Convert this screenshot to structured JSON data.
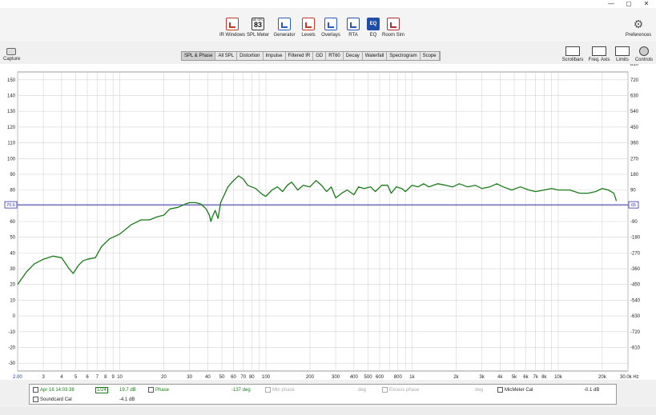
{
  "window": {
    "minimize": "—",
    "restore": "▢",
    "close": "✕"
  },
  "toolbar": {
    "items": [
      {
        "label": "IR Windows",
        "icon": "ir-windows-icon",
        "color": "#c03a2b"
      },
      {
        "label": "SPL Meter",
        "icon": "spl-meter-icon",
        "color": "#333333",
        "badge_top": "dB SPL",
        "badge_value": "83"
      },
      {
        "label": "Generator",
        "icon": "generator-icon",
        "color": "#2b5cb8"
      },
      {
        "label": "Levels",
        "icon": "levels-icon",
        "color": "#c0392b"
      },
      {
        "label": "Overlays",
        "icon": "overlays-icon",
        "color": "#2b5cb8"
      },
      {
        "label": "RTA",
        "icon": "rta-icon",
        "color": "#2b4fb8"
      },
      {
        "label": "EQ",
        "icon": "eq-icon",
        "color": "#1f4ea8",
        "badge_value": "EQ"
      },
      {
        "label": "Room Sim",
        "icon": "room-sim-icon",
        "color": "#b03030"
      }
    ],
    "preferences": "Preferences"
  },
  "capture": "Capture",
  "tabs": [
    {
      "label": "SPL & Phase",
      "active": true
    },
    {
      "label": "All SPL"
    },
    {
      "label": "Distortion"
    },
    {
      "label": "Impulse"
    },
    {
      "label": "Filtered IR"
    },
    {
      "label": "GD"
    },
    {
      "label": "RT60"
    },
    {
      "label": "Decay"
    },
    {
      "label": "Waterfall"
    },
    {
      "label": "Spectrogram"
    },
    {
      "label": "Scope"
    }
  ],
  "right_tools": [
    {
      "label": "Scrollbars",
      "icon": "scrollbars-icon"
    },
    {
      "label": "Freq. Axis",
      "icon": "freq-axis-icon"
    },
    {
      "label": "Limits",
      "icon": "limits-icon"
    },
    {
      "label": "Controls",
      "icon": "controls-icon"
    }
  ],
  "left_unit": "dB",
  "right_unit": "deg",
  "chart_data": {
    "type": "line",
    "x_scale": "log",
    "xlim": [
      2,
      30000
    ],
    "ylim": [
      -35,
      155
    ],
    "y2lim": [
      -945,
      765
    ],
    "x_ticks": [
      "2.00",
      "3",
      "4",
      "5",
      "6",
      "7",
      "8",
      "9",
      "10",
      "20",
      "30",
      "40",
      "50",
      "60",
      "70",
      "80",
      "100",
      "200",
      "300",
      "400",
      "500",
      "600",
      "800",
      "1k",
      "2k",
      "3k",
      "4k",
      "5k",
      "6k",
      "7k",
      "8k",
      "10k",
      "20k",
      "30.0k Hz"
    ],
    "y_ticks": [
      "150",
      "140",
      "130",
      "120",
      "110",
      "100",
      "90",
      "80",
      "70",
      "60",
      "50",
      "40",
      "30",
      "20",
      "10",
      "0",
      "-10",
      "-20",
      "-30"
    ],
    "y2_ticks": [
      "810",
      "720",
      "630",
      "540",
      "450",
      "360",
      "270",
      "180",
      "90",
      "-90",
      "-180",
      "-270",
      "-360",
      "-450",
      "-540",
      "-630",
      "-720",
      "-810"
    ],
    "grid": true,
    "marker_left": "70.6",
    "marker_right": "65",
    "marker_value": 70.6,
    "marker_color": "#3333aa",
    "series": [
      {
        "color": "#1a7a1a",
        "points": [
          [
            2,
            20
          ],
          [
            2.3,
            28
          ],
          [
            2.6,
            33
          ],
          [
            3,
            36
          ],
          [
            3.5,
            38
          ],
          [
            4,
            37
          ],
          [
            4.5,
            30
          ],
          [
            4.8,
            27
          ],
          [
            5.2,
            32
          ],
          [
            5.6,
            35
          ],
          [
            6,
            36
          ],
          [
            6.8,
            37
          ],
          [
            7.5,
            44
          ],
          [
            8.5,
            49
          ],
          [
            10,
            52
          ],
          [
            12,
            58
          ],
          [
            14,
            61
          ],
          [
            16,
            61
          ],
          [
            18,
            63
          ],
          [
            20,
            64
          ],
          [
            22,
            68
          ],
          [
            25,
            69
          ],
          [
            28,
            71
          ],
          [
            30,
            72
          ],
          [
            33,
            72
          ],
          [
            36,
            71
          ],
          [
            39,
            68
          ],
          [
            41,
            64
          ],
          [
            42,
            60
          ],
          [
            43,
            63
          ],
          [
            45,
            67
          ],
          [
            47,
            62
          ],
          [
            49,
            72
          ],
          [
            55,
            82
          ],
          [
            60,
            86
          ],
          [
            65,
            89
          ],
          [
            70,
            87
          ],
          [
            75,
            83
          ],
          [
            85,
            81
          ],
          [
            95,
            77
          ],
          [
            100,
            76
          ],
          [
            110,
            80
          ],
          [
            120,
            82
          ],
          [
            130,
            79
          ],
          [
            140,
            83
          ],
          [
            150,
            85
          ],
          [
            165,
            80
          ],
          [
            180,
            83
          ],
          [
            200,
            82
          ],
          [
            220,
            86
          ],
          [
            240,
            83
          ],
          [
            260,
            79
          ],
          [
            280,
            82
          ],
          [
            300,
            75
          ],
          [
            330,
            78
          ],
          [
            360,
            80
          ],
          [
            400,
            77
          ],
          [
            430,
            82
          ],
          [
            470,
            81
          ],
          [
            520,
            82
          ],
          [
            560,
            79
          ],
          [
            620,
            83
          ],
          [
            680,
            83
          ],
          [
            720,
            78
          ],
          [
            780,
            82
          ],
          [
            850,
            81
          ],
          [
            900,
            79
          ],
          [
            1000,
            83
          ],
          [
            1100,
            82
          ],
          [
            1200,
            84
          ],
          [
            1300,
            82
          ],
          [
            1500,
            84
          ],
          [
            1700,
            83
          ],
          [
            1900,
            82
          ],
          [
            2100,
            84
          ],
          [
            2400,
            82
          ],
          [
            2700,
            83
          ],
          [
            3000,
            81
          ],
          [
            3400,
            82
          ],
          [
            3800,
            84
          ],
          [
            4200,
            82
          ],
          [
            4800,
            80
          ],
          [
            5500,
            82
          ],
          [
            6300,
            80
          ],
          [
            7000,
            79
          ],
          [
            8000,
            80
          ],
          [
            9000,
            81
          ],
          [
            10000,
            80
          ],
          [
            12000,
            80
          ],
          [
            14000,
            78
          ],
          [
            16000,
            78
          ],
          [
            18000,
            79
          ],
          [
            20000,
            81
          ],
          [
            22000,
            80
          ],
          [
            24000,
            78
          ],
          [
            25000,
            73
          ]
        ]
      }
    ]
  },
  "legend": {
    "row1": {
      "date": "Apr 16 14:03:38",
      "smoothing": "1/24",
      "spl_value": "19.7 dB",
      "phase_label": "Phase",
      "phase_value": "-137 deg",
      "minphase_label": "Min phase",
      "minphase_unit": "deg",
      "excess_label": "Excess phase",
      "excess_unit": "deg",
      "mic_label": "MicMeter Cal",
      "mic_value": "-0.1 dB"
    },
    "row2": {
      "soundcard_label": "Soundcard Cal",
      "soundcard_value": "-4.1 dB"
    }
  }
}
